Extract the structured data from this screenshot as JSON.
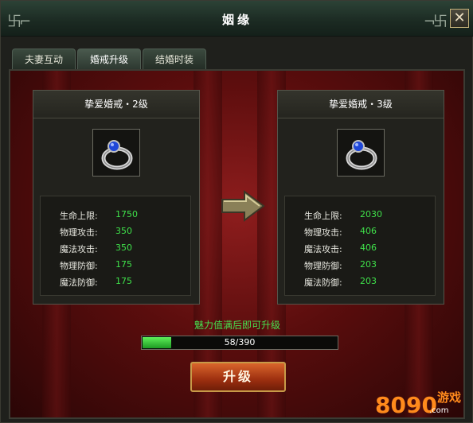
{
  "window": {
    "title": "姻缘",
    "close_glyph": "✕"
  },
  "tabs": [
    {
      "label": "夫妻互动",
      "active": false
    },
    {
      "label": "婚戒升级",
      "active": true
    },
    {
      "label": "结婚时装",
      "active": false
    }
  ],
  "current_ring": {
    "name": "挚爱婚戒・2级",
    "icon": "ring-icon",
    "stats": [
      {
        "label": "生命上限:",
        "value": "1750"
      },
      {
        "label": "物理攻击:",
        "value": "350"
      },
      {
        "label": "魔法攻击:",
        "value": "350"
      },
      {
        "label": "物理防御:",
        "value": "175"
      },
      {
        "label": "魔法防御:",
        "value": "175"
      }
    ]
  },
  "next_ring": {
    "name": "挚爱婚戒・3级",
    "icon": "ring-icon",
    "stats": [
      {
        "label": "生命上限:",
        "value": "2030"
      },
      {
        "label": "物理攻击:",
        "value": "406"
      },
      {
        "label": "魔法攻击:",
        "value": "406"
      },
      {
        "label": "物理防御:",
        "value": "203"
      },
      {
        "label": "魔法防御:",
        "value": "203"
      }
    ]
  },
  "hint": "魅力值满后即可升级",
  "progress": {
    "current": 58,
    "max": 390,
    "text": "58/390"
  },
  "upgrade_button": "升级",
  "watermark": {
    "number": "8090",
    "text": "游戏",
    "url": ".com"
  },
  "colors": {
    "stat_value": "#3fe04a",
    "hint": "#47e04f",
    "button": "#b84418"
  }
}
